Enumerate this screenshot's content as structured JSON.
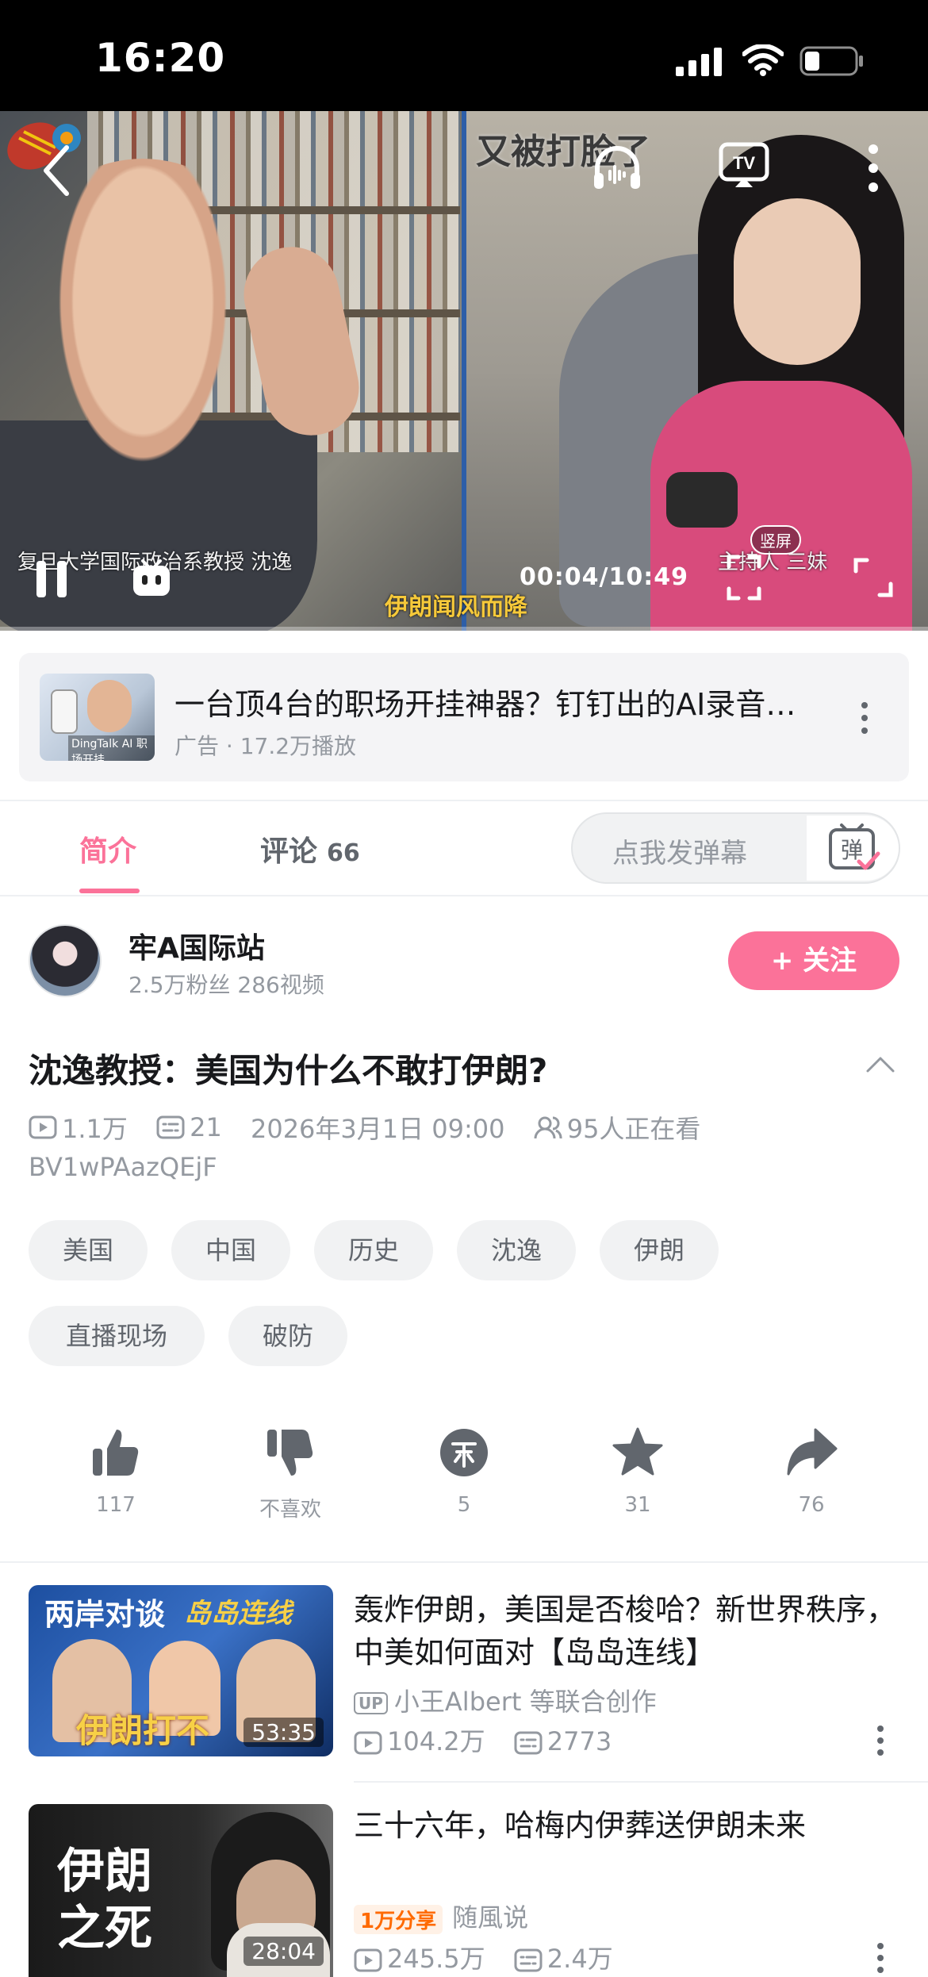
{
  "status_bar": {
    "time": "16:20"
  },
  "player": {
    "overlay_top_text": "又被打脸了",
    "caption_left": "复旦大学国际政治系教授 沈逸",
    "caption_right": "主持人 三妹",
    "subtitle": "伊朗闻风而降",
    "time": "00:04/10:49",
    "vertical_badge": "竖屏",
    "icons": [
      "back-icon",
      "listen-icon",
      "tv-cast-icon",
      "more-icon",
      "pause-icon",
      "danmaku-toggle-icon",
      "vertical-screen-icon",
      "fullscreen-icon"
    ]
  },
  "ad": {
    "title": "一台顶4台的职场开挂神器？钉钉出的AI录音…",
    "meta": "广告 · 17.2万播放",
    "thumb_text": "DingTalk AI 职场开挂"
  },
  "tabs": {
    "intro": "简介",
    "comments": "评论",
    "comments_count": "66"
  },
  "danmaku": {
    "placeholder": "点我发弹幕",
    "send_glyph": "弹"
  },
  "uploader": {
    "name": "牢A国际站",
    "stats": "2.5万粉丝  286视频",
    "follow_label": "+ 关注"
  },
  "video": {
    "title": "沈逸教授：美国为什么不敢打伊朗?",
    "views": "1.1万",
    "danmaku_count": "21",
    "date": "2026年3月1日 09:00",
    "watching": "95人正在看",
    "bvid": "BV1wPAazQEjF"
  },
  "tags": [
    "美国",
    "中国",
    "历史",
    "沈逸",
    "伊朗",
    "直播现场",
    "破防"
  ],
  "actions": {
    "like": "117",
    "dislike": "不喜欢",
    "coin": "5",
    "favorite": "31",
    "share": "76"
  },
  "related": [
    {
      "title": "轰炸伊朗，美国是否梭哈？新世界秩序，中美如何面对【岛岛连线】",
      "author": "小王Albert 等联合创作",
      "views": "104.2万",
      "danmaku": "2773",
      "duration": "53:35",
      "thumb_top": "两岸对谈",
      "thumb_badge": "岛岛连线",
      "thumb_bottom": "伊朗打不"
    },
    {
      "title": "三十六年，哈梅内伊葬送伊朗未来",
      "share_badge": "1万分享",
      "author": "随風说",
      "views": "245.5万",
      "danmaku": "2.4万",
      "duration": "28:04",
      "thumb_line1": "伊朗",
      "thumb_line2": "之死"
    }
  ],
  "colors": {
    "accent": "#fb7299",
    "text_secondary": "#9499a0",
    "status_bar_bg": "#000000"
  }
}
